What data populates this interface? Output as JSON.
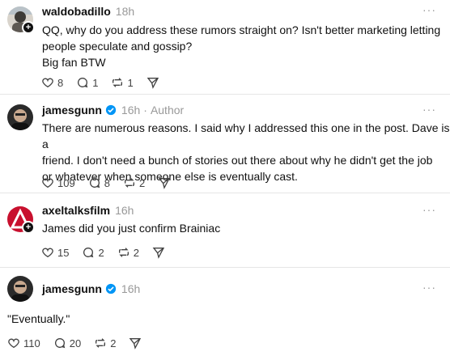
{
  "posts": [
    {
      "username": "waldobadillo",
      "time": "18h",
      "author_label": "",
      "verified": false,
      "lines": [
        "QQ, why do you address these rumors straight on? Isn't better marketing letting",
        "people speculate and gossip?",
        "Big fan BTW"
      ],
      "likes": "8",
      "replies": "1",
      "reposts": "1",
      "more_label": "···"
    },
    {
      "username": "jamesgunn",
      "time": "16h",
      "author_label": "Author",
      "author_sep": "·",
      "verified": true,
      "lines": [
        "There are numerous reasons. I said why I addressed this one in the post. Dave is a",
        "friend. I don't need a bunch of stories out there about why he didn't get the job",
        "or whatever when someone else is eventually cast."
      ],
      "likes": "109",
      "replies": "8",
      "reposts": "2",
      "more_label": "···"
    },
    {
      "username": "axeltalksfilm",
      "time": "16h",
      "author_label": "",
      "verified": false,
      "lines": [
        "James did you just confirm Brainiac"
      ],
      "likes": "15",
      "replies": "2",
      "reposts": "2",
      "more_label": "···"
    },
    {
      "username": "jamesgunn",
      "time": "16h",
      "author_label": "",
      "verified": true,
      "lines": [
        "\"Eventually.\""
      ],
      "likes": "110",
      "replies": "20",
      "reposts": "2",
      "more_label": "···"
    }
  ],
  "colors": {
    "text": "#101010",
    "muted": "#999999",
    "icon": "#424242",
    "verified": "#0095f6",
    "divider": "#e6e6e6"
  }
}
